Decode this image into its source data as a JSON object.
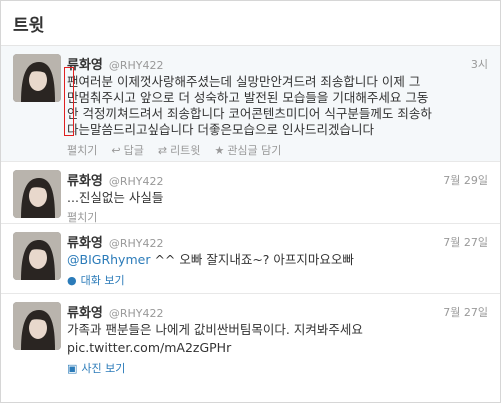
{
  "header": {
    "title": "트윗"
  },
  "tweets": [
    {
      "name": "류화영",
      "handle": "@RHY422",
      "time": "3시",
      "lines": [
        "팬여러분 이제껏사랑해주셨는데 실망만안겨드려 죄송합니다 이제 그",
        "만멈춰주시고 앞으로 더 성숙하고 발전된 모습들을 기대해주세요 그동",
        "안 걱정끼쳐드려서 죄송합니다 코어콘텐츠미디어 식구분들께도 죄송하",
        "다는말씀드리고싶습니다 더좋은모습으로 인사드리겠습니다"
      ],
      "actions": {
        "collapse": "펼치기",
        "reply": "답글",
        "retweet": "리트윗",
        "favorite": "관심글 담기"
      }
    },
    {
      "name": "류화영",
      "handle": "@RHY422",
      "time": "7월 29일",
      "text": "...진실없는 사실들",
      "expand": "펼치기"
    },
    {
      "name": "류화영",
      "handle": "@RHY422",
      "time": "7월 27일",
      "mention": "@BIGRhymer",
      "text": " ^^ 오빠 잘지내죠~? 아프지마요오빠",
      "meta": "대화 보기"
    },
    {
      "name": "류화영",
      "handle": "@RHY422",
      "time": "7월 27일",
      "text": "가족과 팬분들은 나에게 값비싼버팀목이다. 지켜봐주세요",
      "link": "pic.twitter.com/mA2zGPHr",
      "meta": "사진 보기"
    }
  ],
  "icons": {
    "reply": "reply-icon",
    "retweet": "retweet-icon",
    "favorite": "star-icon",
    "conversation": "conversation-icon",
    "photo": "photo-icon"
  },
  "colors": {
    "link": "#2b7bb9",
    "highlight_box": "#e02020",
    "muted": "#999999"
  }
}
